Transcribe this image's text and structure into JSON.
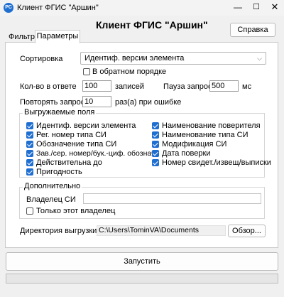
{
  "window": {
    "icon_text": "РС",
    "title": "Клиент ФГИС \"Аршин\"",
    "minimize_glyph": "—",
    "maximize_glyph": "☐",
    "close_glyph": "✕"
  },
  "header": {
    "title": "Клиент ФГИС \"Аршин\"",
    "help_label": "Справка"
  },
  "tabs": [
    {
      "label": "Фильтр",
      "active": false
    },
    {
      "label": "Параметры",
      "active": true
    }
  ],
  "params": {
    "sort_label": "Сортировка",
    "sort_value": "Идентиф. версии элемента",
    "reverse": {
      "label": "В обратном порядке",
      "checked": false
    },
    "count_label": "Кол-во в ответе",
    "count_value": "100",
    "count_unit": "записей",
    "pause_label": "Пауза запроса",
    "pause_value": "500",
    "pause_unit": "мс",
    "retry_label": "Повторять запрос",
    "retry_value": "10",
    "retry_unit": "раз(а) при ошибке"
  },
  "fields_group": {
    "title": "Выгружаемые поля",
    "left": [
      {
        "label": "Идентиф. версии элемента",
        "checked": true
      },
      {
        "label": "Рег. номер типа СИ",
        "checked": true
      },
      {
        "label": "Обозначение типа СИ",
        "checked": true
      },
      {
        "label": "Зав./сер. номер/бук.-циф. обознач.",
        "checked": true
      },
      {
        "label": "Действительна до",
        "checked": true
      },
      {
        "label": "Пригодность",
        "checked": true
      }
    ],
    "right": [
      {
        "label": "Наименование поверителя",
        "checked": true
      },
      {
        "label": "Наименование типа СИ",
        "checked": true
      },
      {
        "label": "Модификация СИ",
        "checked": true
      },
      {
        "label": "Дата поверки",
        "checked": true
      },
      {
        "label": "Номер свидет./извещ/выписки",
        "checked": true
      }
    ]
  },
  "extra_group": {
    "title": "Дополнительно",
    "owner_label": "Владелец СИ",
    "owner_value": "",
    "only_owner": {
      "label": "Только этот владелец",
      "checked": false
    }
  },
  "export": {
    "dir_label": "Директория выгрузки",
    "dir_value": "C:\\Users\\TominVA\\Documents",
    "browse_label": "Обзор..."
  },
  "start_label": "Запустить",
  "progress_value": 0,
  "colors": {
    "accent": "#1f6fd1",
    "progress": "#06b025"
  }
}
